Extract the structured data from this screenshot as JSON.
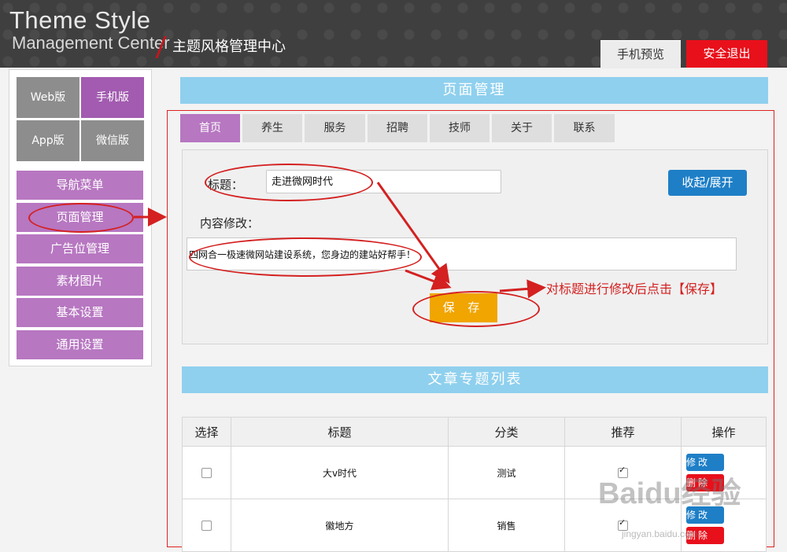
{
  "header": {
    "brand_title": "Theme Style",
    "brand_sub": "Management Center",
    "brand_cn": "主题风格管理中心",
    "preview_label": "手机预览",
    "logout_label": "安全退出"
  },
  "sidebar": {
    "versions": [
      "Web版",
      "手机版",
      "App版",
      "微信版"
    ],
    "menu": [
      "导航菜单",
      "页面管理",
      "广告位管理",
      "素材图片",
      "基本设置",
      "通用设置"
    ]
  },
  "main": {
    "section_title": "页面管理",
    "tabs": [
      "首页",
      "养生",
      "服务",
      "招聘",
      "技师",
      "关于",
      "联系"
    ],
    "form": {
      "title_label": "标题：",
      "title_value": "走进微网时代",
      "toggle_label": "收起/展开",
      "content_label": "内容修改：",
      "content_value": "四网合一极速微网站建设系统，您身边的建站好帮手！",
      "save_label": "保 存"
    },
    "annotation": "对标题进行修改后点击【保存】"
  },
  "articles": {
    "section_title": "文章专题列表",
    "columns": [
      "选择",
      "标题",
      "分类",
      "推荐",
      "操作"
    ],
    "rows": [
      {
        "title": "大v时代",
        "category": "测试",
        "recommended": true
      },
      {
        "title": "徽地方",
        "category": "销售",
        "recommended": true
      }
    ],
    "edit_label": "修改",
    "delete_label": "删除"
  },
  "watermark": {
    "logo": "Baidu经验",
    "url": "jingyan.baidu.com"
  },
  "colors": {
    "accent_purple": "#b777c1",
    "sky_blue": "#8fd0ee",
    "primary_blue": "#1e7fc7",
    "danger_red": "#e8101b",
    "save_orange": "#f0a500"
  }
}
